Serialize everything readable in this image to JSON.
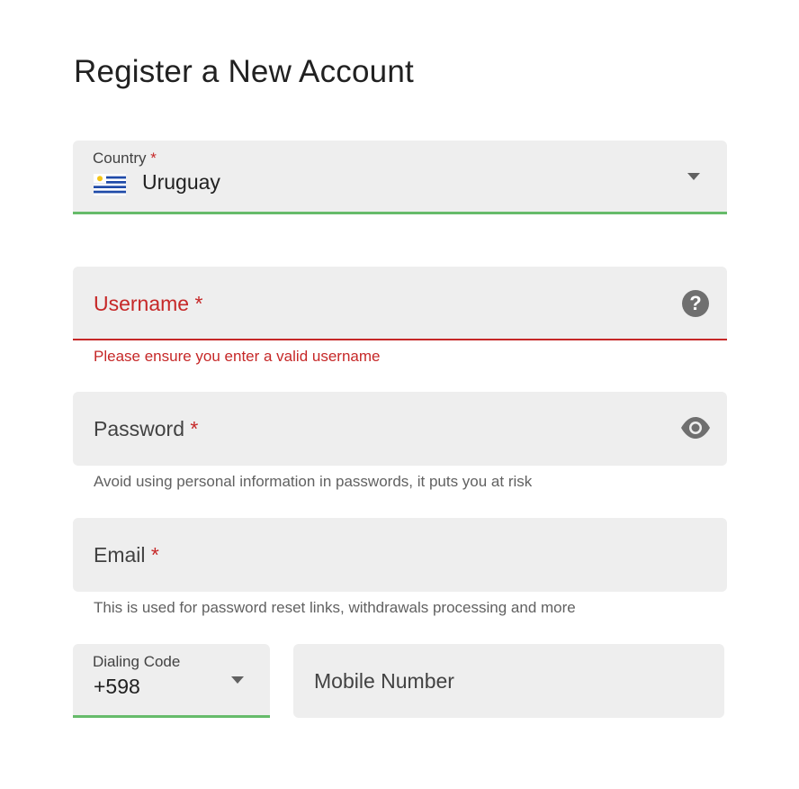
{
  "page": {
    "title": "Register a New Account"
  },
  "country": {
    "label": "Country",
    "required_mark": "*",
    "value": "Uruguay",
    "flag_icon": "uruguay-flag-icon",
    "status_color": "#66bb6a"
  },
  "username": {
    "label": "Username",
    "required_mark": "*",
    "error": "Please ensure you enter a valid username",
    "icon": "help-icon",
    "help_glyph": "?",
    "error_color": "#c62828"
  },
  "password": {
    "label": "Password",
    "required_mark": "*",
    "helper": "Avoid using personal information in passwords, it puts you at risk",
    "icon": "eye-icon"
  },
  "email": {
    "label": "Email",
    "required_mark": "*",
    "helper": "This is used for password reset links, withdrawals processing and more"
  },
  "dialing_code": {
    "label": "Dialing Code",
    "value": "+598",
    "icon": "chevron-down-icon"
  },
  "mobile": {
    "placeholder": "Mobile Number"
  }
}
